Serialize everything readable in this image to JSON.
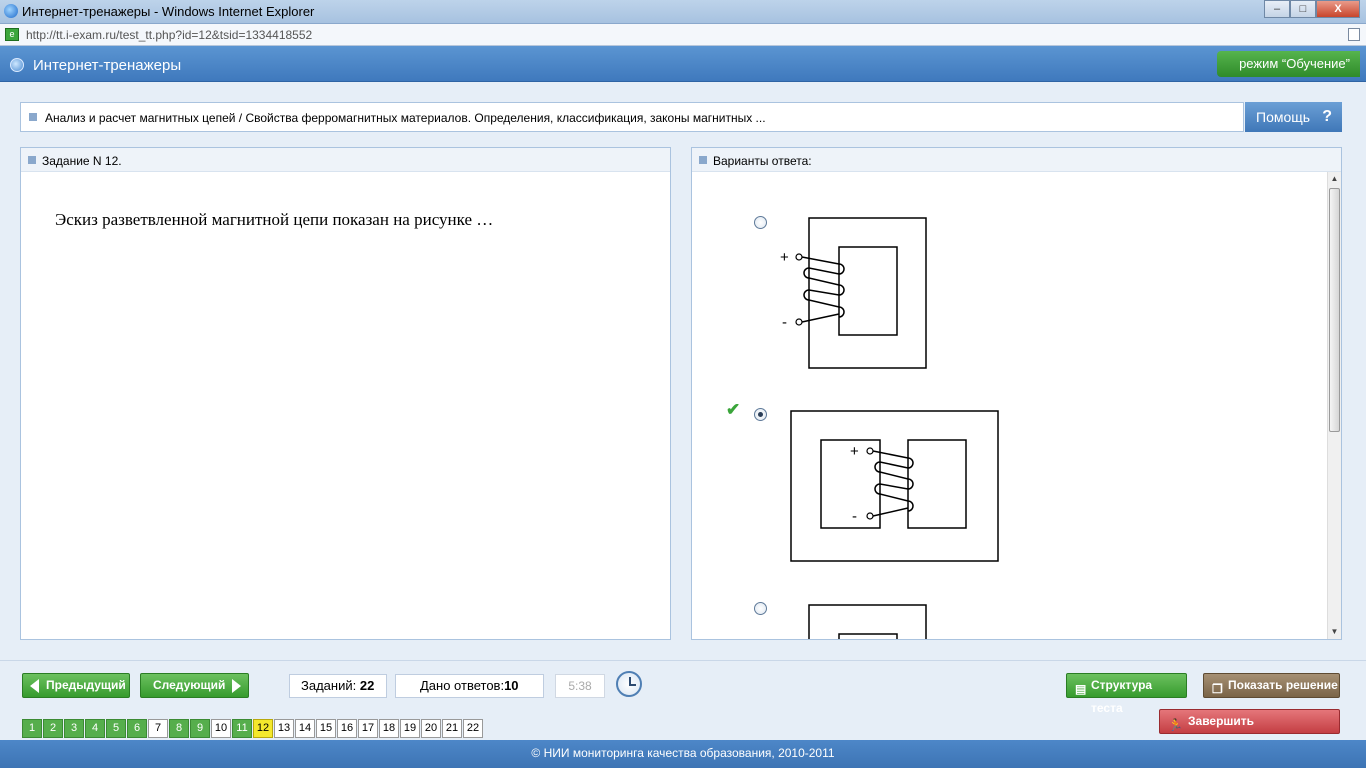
{
  "browser": {
    "title": "Интернет-тренажеры - Windows Internet Explorer",
    "url": "http://tt.i-exam.ru/test_tt.php?id=12&tsid=1334418552",
    "controls": [
      "–",
      "□",
      "X"
    ]
  },
  "header": {
    "title": "Интернет-тренажеры",
    "mode": "режим “Обучение”"
  },
  "breadcrumb": "Анализ и расчет магнитных цепей / Свойства ферромагнитных материалов. Определения, классификация, законы магнитных ...",
  "help": {
    "label": "Помощь",
    "icon": "?"
  },
  "task": {
    "header": "Задание N 12.",
    "question": "Эскиз разветвленной магнитной цепи показан на рисунке …"
  },
  "answers": {
    "header": "Варианты ответа:",
    "options": [
      {
        "selected": false,
        "correct": false,
        "plus": "+",
        "minus": "-"
      },
      {
        "selected": true,
        "correct": true,
        "plus": "+",
        "minus": "-"
      },
      {
        "selected": false,
        "correct": false
      }
    ]
  },
  "toolbar": {
    "prev": "Предыдущий",
    "next": "Следующий",
    "tasks_label": "Заданий:",
    "tasks_count": "22",
    "answers_label": "Дано ответов:",
    "answers_count": "10",
    "timer": "5:38",
    "structure": "Структура теста",
    "show_solution": "Показать решение",
    "finish": "Завершить тестирование",
    "icons": {
      "structure": "list-icon",
      "show_solution": "book-icon",
      "finish": "runner-icon",
      "clock": "clock-icon"
    },
    "colors": {
      "answered": "#56ae4c",
      "current": "#f4e82c",
      "unanswered": "#ffffff"
    }
  },
  "pager": [
    {
      "num": "1",
      "state": "answered"
    },
    {
      "num": "2",
      "state": "answered"
    },
    {
      "num": "3",
      "state": "answered"
    },
    {
      "num": "4",
      "state": "answered"
    },
    {
      "num": "5",
      "state": "answered"
    },
    {
      "num": "6",
      "state": "answered"
    },
    {
      "num": "7",
      "state": "unanswered"
    },
    {
      "num": "8",
      "state": "answered"
    },
    {
      "num": "9",
      "state": "answered"
    },
    {
      "num": "10",
      "state": "unanswered"
    },
    {
      "num": "11",
      "state": "answered"
    },
    {
      "num": "12",
      "state": "current"
    },
    {
      "num": "13",
      "state": "unanswered"
    },
    {
      "num": "14",
      "state": "unanswered"
    },
    {
      "num": "15",
      "state": "unanswered"
    },
    {
      "num": "16",
      "state": "unanswered"
    },
    {
      "num": "17",
      "state": "unanswered"
    },
    {
      "num": "18",
      "state": "unanswered"
    },
    {
      "num": "19",
      "state": "unanswered"
    },
    {
      "num": "20",
      "state": "unanswered"
    },
    {
      "num": "21",
      "state": "unanswered"
    },
    {
      "num": "22",
      "state": "unanswered"
    }
  ],
  "footer": "© НИИ мониторинга качества образования, 2010-2011"
}
